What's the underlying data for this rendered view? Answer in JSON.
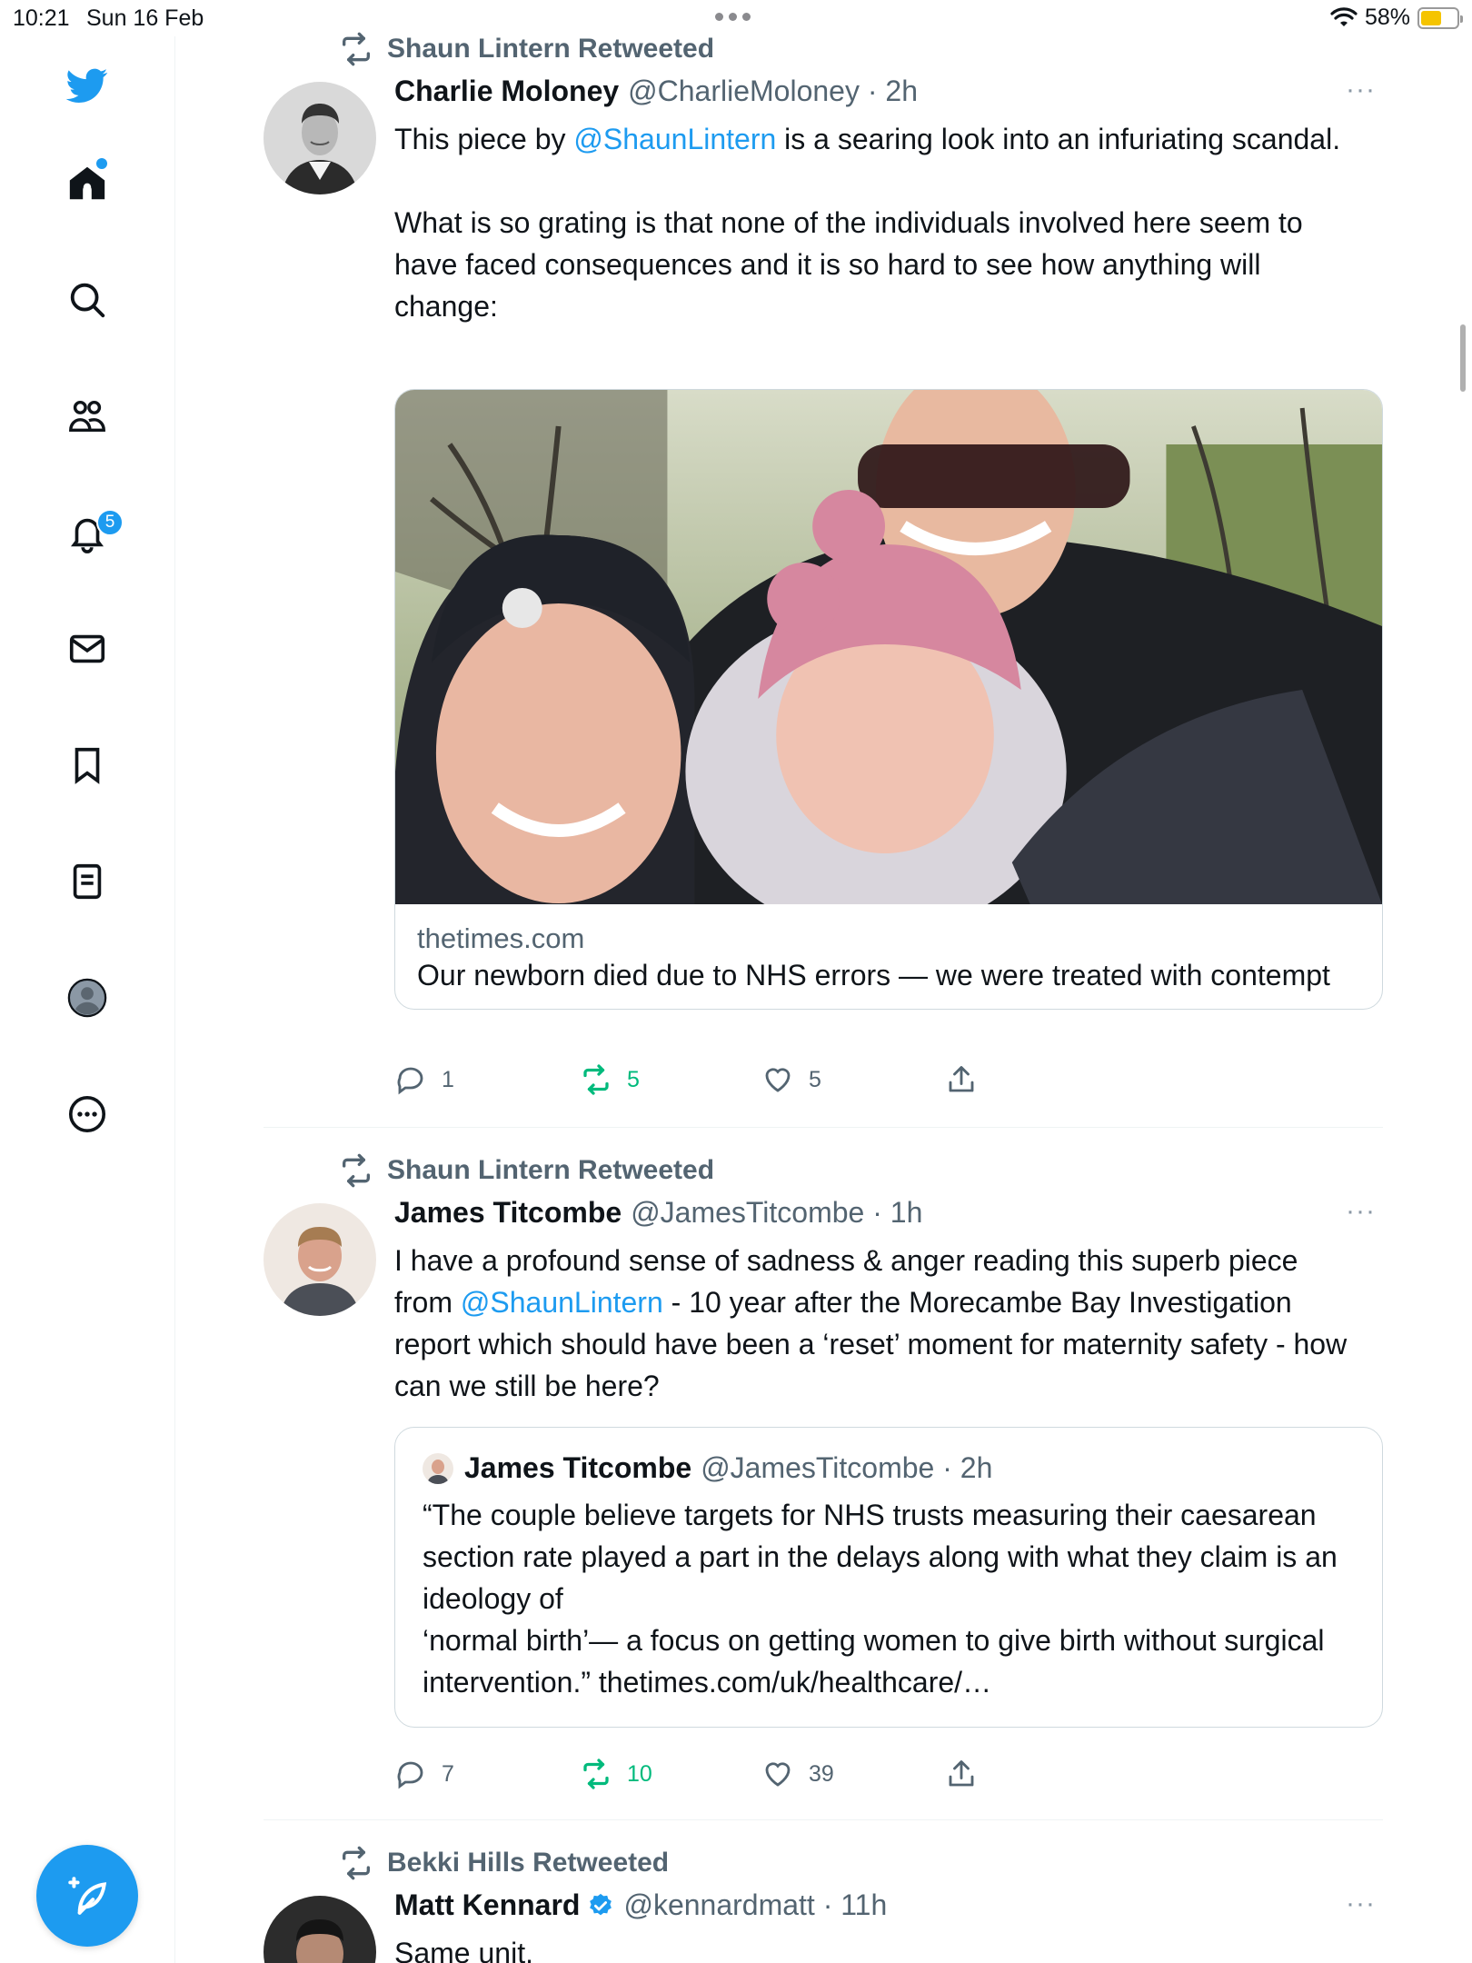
{
  "status_bar": {
    "time": "10:21",
    "date": "Sun 16 Feb",
    "battery": "58%",
    "battery_level": 0.58
  },
  "sidebar": {
    "items": [
      {
        "name": "home",
        "icon": "home-icon"
      },
      {
        "name": "explore",
        "icon": "search-icon"
      },
      {
        "name": "communities",
        "icon": "communities-icon"
      },
      {
        "name": "notifications",
        "icon": "bell-icon",
        "badge": "5"
      },
      {
        "name": "messages",
        "icon": "mail-icon"
      },
      {
        "name": "bookmarks",
        "icon": "bookmark-icon"
      },
      {
        "name": "lists",
        "icon": "lists-icon"
      },
      {
        "name": "profile",
        "icon": "profile-icon"
      },
      {
        "name": "more",
        "icon": "more-circle-icon"
      }
    ],
    "compose_icon": "compose-icon",
    "brand_color": "#1d9bf0"
  },
  "tweets": [
    {
      "retweeted_by": "Shaun Lintern Retweeted",
      "name": "Charlie Moloney",
      "handle": "@CharlieMoloney · 2h",
      "text_pre": "This piece by ",
      "mention": "@ShaunLintern",
      "text_post": " is a searing look into an infuriating scandal.",
      "text_p2": "What is so grating is that none of the individuals involved here seem to have faced consequences and it is so hard to see how anything will change:",
      "card": {
        "domain": "thetimes.com",
        "title": "Our newborn died due to NHS errors — we were treated with contempt"
      },
      "replies": "1",
      "retweets": "5",
      "likes": "5"
    },
    {
      "retweeted_by": "Shaun Lintern Retweeted",
      "name": "James Titcombe",
      "handle": "@JamesTitcombe · 1h",
      "text_pre": "I have a profound sense of sadness & anger reading this superb piece from ",
      "mention": "@ShaunLintern",
      "text_post": " - 10 year after the Morecambe Bay Investigation report which should have been a ‘reset’ moment for maternity safety - how can we still be here?",
      "quote": {
        "name": "James Titcombe",
        "handle": "@JamesTitcombe · 2h",
        "text1": "“The couple believe targets for NHS trusts measuring their caesarean section rate played a part in the delays along with what they claim is an ideology of",
        "text2": "‘normal birth’— a focus on getting women to give birth without surgical intervention.” thetimes.com/uk/healthcare/…"
      },
      "replies": "7",
      "retweets": "10",
      "likes": "39"
    },
    {
      "retweeted_by": "Bekki Hills Retweeted",
      "name": "Matt Kennard",
      "verified": true,
      "handle": "@kennardmatt · 11h",
      "text": "Same unit."
    }
  ],
  "more_label": "···"
}
